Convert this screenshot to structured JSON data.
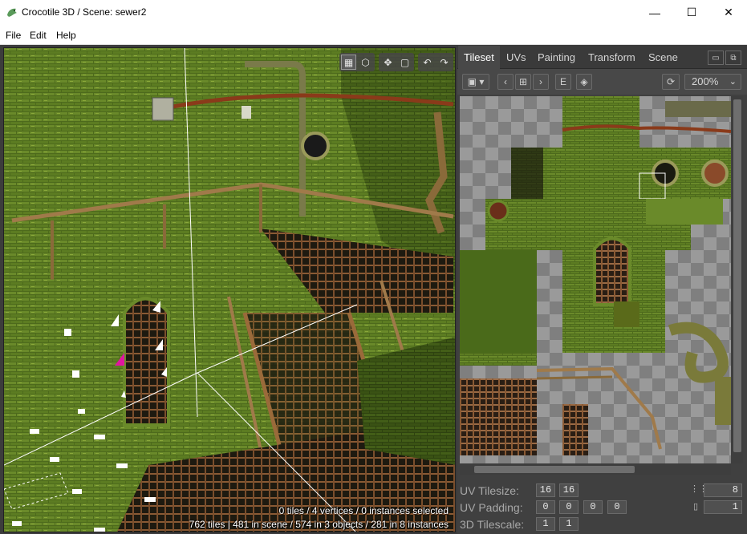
{
  "window": {
    "title": "Crocotile 3D / Scene: sewer2",
    "controls": {
      "minimize": "—",
      "maximize": "☐",
      "close": "✕"
    }
  },
  "menu": {
    "items": [
      "File",
      "Edit",
      "Help"
    ]
  },
  "viewport": {
    "toolbar_icons": [
      "grid-icon",
      "cube-icon",
      "move-icon",
      "select-box-icon",
      "undo-icon",
      "redo-icon"
    ],
    "status_line1": "0 tiles / 4 vertices / 0 instances selected",
    "status_line2": "762 tiles | 481 in scene / 574 in 3 objects / 281 in 8 instances"
  },
  "panel": {
    "tabs": [
      "Tileset",
      "UVs",
      "Painting",
      "Transform",
      "Scene"
    ],
    "active_tab": "Tileset",
    "toolbar": {
      "image_icon": "image-icon",
      "prev_icon": "chevron-left-icon",
      "grid_icon": "tiles-grid-icon",
      "next_icon": "chevron-right-icon",
      "edit_label": "E",
      "layers_icon": "diamond-icon",
      "refresh_icon": "refresh-icon",
      "zoom": "200%"
    },
    "props": {
      "uv_tilesize_label": "UV Tilesize:",
      "uv_tilesize": [
        "16",
        "16"
      ],
      "uv_padding_label": "UV Padding:",
      "uv_padding": [
        "0",
        "0",
        "0",
        "0"
      ],
      "tilescale_label": "3D Tilescale:",
      "tilescale": [
        "1",
        "1"
      ],
      "right_value_1": "8",
      "right_value_2": "1"
    }
  },
  "colors": {
    "accent_pink": "#e0159f",
    "panel_bg": "#404040",
    "tab_active": "#484848"
  }
}
